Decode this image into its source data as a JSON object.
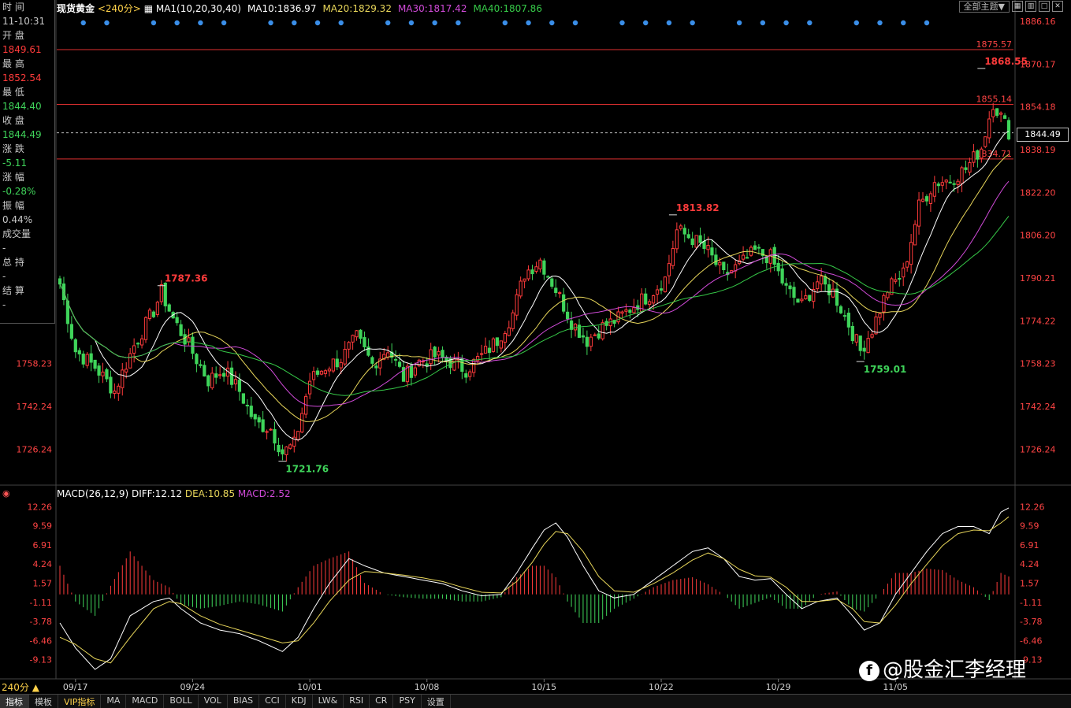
{
  "header": {
    "symbol": "现货黄金",
    "period": "<240分>",
    "ma": [
      {
        "text": "MA1(10,20,30,40)",
        "color": "#ffffff"
      },
      {
        "text": "MA10:1836.97",
        "color": "#ffffff"
      },
      {
        "text": "MA20:1829.32",
        "color": "#e8d65a"
      },
      {
        "text": "MA30:1817.42",
        "color": "#d04ad8"
      },
      {
        "text": "MA40:1807.86",
        "color": "#36c948"
      }
    ]
  },
  "theme_button": "全部主题▼",
  "sidebar": [
    {
      "label": "时 间",
      "value": "11-10:31",
      "tone": "neu"
    },
    {
      "label": "开 盘",
      "value": "1849.61",
      "tone": "up"
    },
    {
      "label": "最 高",
      "value": "1852.54",
      "tone": "up"
    },
    {
      "label": "最 低",
      "value": "1844.40",
      "tone": "dn"
    },
    {
      "label": "收 盘",
      "value": "1844.49",
      "tone": "dn"
    },
    {
      "label": "涨 跌",
      "value": "-5.11",
      "tone": "dn"
    },
    {
      "label": "涨 幅",
      "value": "-0.28%",
      "tone": "dn"
    },
    {
      "label": "振 幅",
      "value": "0.44%",
      "tone": "neu"
    },
    {
      "label": "成交量",
      "value": "-",
      "tone": "neu"
    },
    {
      "label": "总 持",
      "value": "-",
      "tone": "neu"
    },
    {
      "label": "结 算",
      "value": "-",
      "tone": "neu"
    }
  ],
  "current_price": "1844.49",
  "macd_header": {
    "name": "MACD(26,12,9)",
    "diff": "DIFF:12.12",
    "dea": "DEA:10.85",
    "macd": "MACD:2.52"
  },
  "period_tag": "240分 ▲",
  "toolbar": [
    "指标",
    "模板",
    "VIP指标",
    "MA",
    "MACD",
    "BOLL",
    "VOL",
    "BIAS",
    "CCI",
    "KDJ",
    "LW&",
    "RSI",
    "CR",
    "PSY",
    "设置"
  ],
  "watermark": "@股金汇李经理",
  "colors": {
    "up": "#ff3b3b",
    "down": "#3fd45a",
    "axis": "#ff4444",
    "ma10": "#ffffff",
    "ma20": "#e8d65a",
    "ma30": "#d04ad8",
    "ma40": "#36c948"
  },
  "chart_data": {
    "type": "candlestick",
    "price_ticks": [
      1886.16,
      1870.17,
      1854.18,
      1838.19,
      1822.2,
      1806.2,
      1790.21,
      1774.22,
      1758.23,
      1742.24,
      1726.24
    ],
    "price_range": [
      1714,
      1890
    ],
    "x_labels": [
      {
        "label": "09/17",
        "index": 4
      },
      {
        "label": "09/24",
        "index": 34
      },
      {
        "label": "10/01",
        "index": 64
      },
      {
        "label": "10/08",
        "index": 94
      },
      {
        "label": "10/15",
        "index": 124
      },
      {
        "label": "10/22",
        "index": 154
      },
      {
        "label": "10/29",
        "index": 184
      },
      {
        "label": "11/05",
        "index": 214
      }
    ],
    "horizontal_lines": [
      {
        "value": 1875.57,
        "label": "1875.57"
      },
      {
        "value": 1855.14,
        "label": "1855.14"
      },
      {
        "value": 1834.71,
        "label": "1834.71"
      }
    ],
    "annotations": [
      {
        "label": "1787.36",
        "index": 26,
        "value": 1787.36,
        "kind": "high"
      },
      {
        "label": "1721.76",
        "index": 57,
        "value": 1721.76,
        "kind": "low"
      },
      {
        "label": "1813.82",
        "index": 157,
        "value": 1813.82,
        "kind": "high"
      },
      {
        "label": "1759.01",
        "index": 205,
        "value": 1759.01,
        "kind": "low"
      },
      {
        "label": "1868.55",
        "index": 236,
        "value": 1868.55,
        "kind": "high"
      }
    ],
    "close_anchors": [
      [
        0,
        1788
      ],
      [
        4,
        1763
      ],
      [
        9,
        1757
      ],
      [
        14,
        1748
      ],
      [
        19,
        1765
      ],
      [
        24,
        1778
      ],
      [
        26,
        1785
      ],
      [
        29,
        1775
      ],
      [
        33,
        1765
      ],
      [
        38,
        1752
      ],
      [
        42,
        1756
      ],
      [
        46,
        1748
      ],
      [
        50,
        1736
      ],
      [
        54,
        1734
      ],
      [
        57,
        1725
      ],
      [
        60,
        1728
      ],
      [
        64,
        1752
      ],
      [
        68,
        1757
      ],
      [
        72,
        1760
      ],
      [
        76,
        1768
      ],
      [
        80,
        1758
      ],
      [
        84,
        1764
      ],
      [
        88,
        1753
      ],
      [
        92,
        1759
      ],
      [
        96,
        1761
      ],
      [
        100,
        1759
      ],
      [
        104,
        1756
      ],
      [
        108,
        1761
      ],
      [
        112,
        1767
      ],
      [
        116,
        1777
      ],
      [
        119,
        1792
      ],
      [
        123,
        1797
      ],
      [
        127,
        1786
      ],
      [
        131,
        1774
      ],
      [
        135,
        1767
      ],
      [
        139,
        1772
      ],
      [
        143,
        1775
      ],
      [
        147,
        1780
      ],
      [
        151,
        1784
      ],
      [
        155,
        1790
      ],
      [
        158,
        1808
      ],
      [
        162,
        1805
      ],
      [
        166,
        1800
      ],
      [
        170,
        1791
      ],
      [
        174,
        1795
      ],
      [
        178,
        1800
      ],
      [
        182,
        1798
      ],
      [
        186,
        1786
      ],
      [
        190,
        1780
      ],
      [
        194,
        1789
      ],
      [
        198,
        1785
      ],
      [
        202,
        1773
      ],
      [
        205,
        1763
      ],
      [
        208,
        1771
      ],
      [
        212,
        1786
      ],
      [
        216,
        1792
      ],
      [
        220,
        1817
      ],
      [
        224,
        1826
      ],
      [
        228,
        1827
      ],
      [
        232,
        1831
      ],
      [
        236,
        1839
      ],
      [
        239,
        1856
      ],
      [
        243,
        1845
      ]
    ],
    "bar_count": 244,
    "macd": {
      "ticks": [
        12.26,
        9.59,
        6.91,
        4.24,
        1.57,
        -1.11,
        -3.78,
        -6.46,
        -9.13
      ],
      "range": [
        -11.6,
        13.3
      ],
      "diff_anchors": [
        [
          0,
          -4
        ],
        [
          4,
          -7.5
        ],
        [
          9,
          -10.5
        ],
        [
          13,
          -9
        ],
        [
          18,
          -3
        ],
        [
          24,
          -1
        ],
        [
          28,
          -0.5
        ],
        [
          31,
          -2
        ],
        [
          36,
          -4
        ],
        [
          41,
          -5
        ],
        [
          46,
          -5.5
        ],
        [
          51,
          -6.5
        ],
        [
          57,
          -8
        ],
        [
          61,
          -6
        ],
        [
          65,
          -2
        ],
        [
          69,
          1.5
        ],
        [
          74,
          5
        ],
        [
          78,
          4
        ],
        [
          83,
          3
        ],
        [
          88,
          2.5
        ],
        [
          93,
          2
        ],
        [
          98,
          1.5
        ],
        [
          103,
          0.5
        ],
        [
          108,
          -0.2
        ],
        [
          113,
          0
        ],
        [
          117,
          3
        ],
        [
          121,
          6.5
        ],
        [
          124,
          9
        ],
        [
          127,
          10
        ],
        [
          130,
          8
        ],
        [
          134,
          4
        ],
        [
          138,
          0.5
        ],
        [
          142,
          -0.5
        ],
        [
          147,
          0
        ],
        [
          152,
          2
        ],
        [
          157,
          4
        ],
        [
          162,
          6
        ],
        [
          166,
          6.5
        ],
        [
          170,
          5
        ],
        [
          174,
          2.5
        ],
        [
          178,
          2
        ],
        [
          182,
          2.2
        ],
        [
          186,
          0
        ],
        [
          190,
          -2
        ],
        [
          194,
          -1
        ],
        [
          199,
          -0.5
        ],
        [
          203,
          -3
        ],
        [
          206,
          -5
        ],
        [
          210,
          -4
        ],
        [
          214,
          0
        ],
        [
          218,
          3
        ],
        [
          222,
          6
        ],
        [
          226,
          8.5
        ],
        [
          230,
          9.5
        ],
        [
          234,
          9.5
        ],
        [
          238,
          8.5
        ],
        [
          241,
          11.5
        ],
        [
          243,
          12.1
        ]
      ],
      "dea_anchors": [
        [
          0,
          -6
        ],
        [
          4,
          -7
        ],
        [
          9,
          -9
        ],
        [
          13,
          -9.6
        ],
        [
          18,
          -6
        ],
        [
          24,
          -2
        ],
        [
          28,
          -1
        ],
        [
          31,
          -1.3
        ],
        [
          36,
          -3
        ],
        [
          41,
          -4.2
        ],
        [
          46,
          -5
        ],
        [
          51,
          -5.8
        ],
        [
          57,
          -6.8
        ],
        [
          61,
          -6.5
        ],
        [
          65,
          -4
        ],
        [
          69,
          -1
        ],
        [
          74,
          2
        ],
        [
          78,
          3.2
        ],
        [
          83,
          3
        ],
        [
          88,
          2.7
        ],
        [
          93,
          2.3
        ],
        [
          98,
          1.8
        ],
        [
          103,
          1
        ],
        [
          108,
          0.3
        ],
        [
          113,
          0.2
        ],
        [
          117,
          1.8
        ],
        [
          121,
          4.5
        ],
        [
          124,
          7
        ],
        [
          127,
          8.8
        ],
        [
          130,
          8.5
        ],
        [
          134,
          6
        ],
        [
          138,
          2.5
        ],
        [
          142,
          0.5
        ],
        [
          147,
          0.3
        ],
        [
          152,
          1.5
        ],
        [
          157,
          3
        ],
        [
          162,
          4.8
        ],
        [
          166,
          5.8
        ],
        [
          170,
          5
        ],
        [
          174,
          3.5
        ],
        [
          178,
          2.6
        ],
        [
          182,
          2.4
        ],
        [
          186,
          1
        ],
        [
          190,
          -1
        ],
        [
          194,
          -1
        ],
        [
          199,
          -0.7
        ],
        [
          203,
          -2
        ],
        [
          206,
          -3.8
        ],
        [
          210,
          -4
        ],
        [
          214,
          -1.5
        ],
        [
          218,
          1.5
        ],
        [
          222,
          4.2
        ],
        [
          226,
          6.8
        ],
        [
          230,
          8.5
        ],
        [
          234,
          9
        ],
        [
          238,
          8.9
        ],
        [
          241,
          10
        ],
        [
          243,
          10.85
        ]
      ]
    }
  }
}
